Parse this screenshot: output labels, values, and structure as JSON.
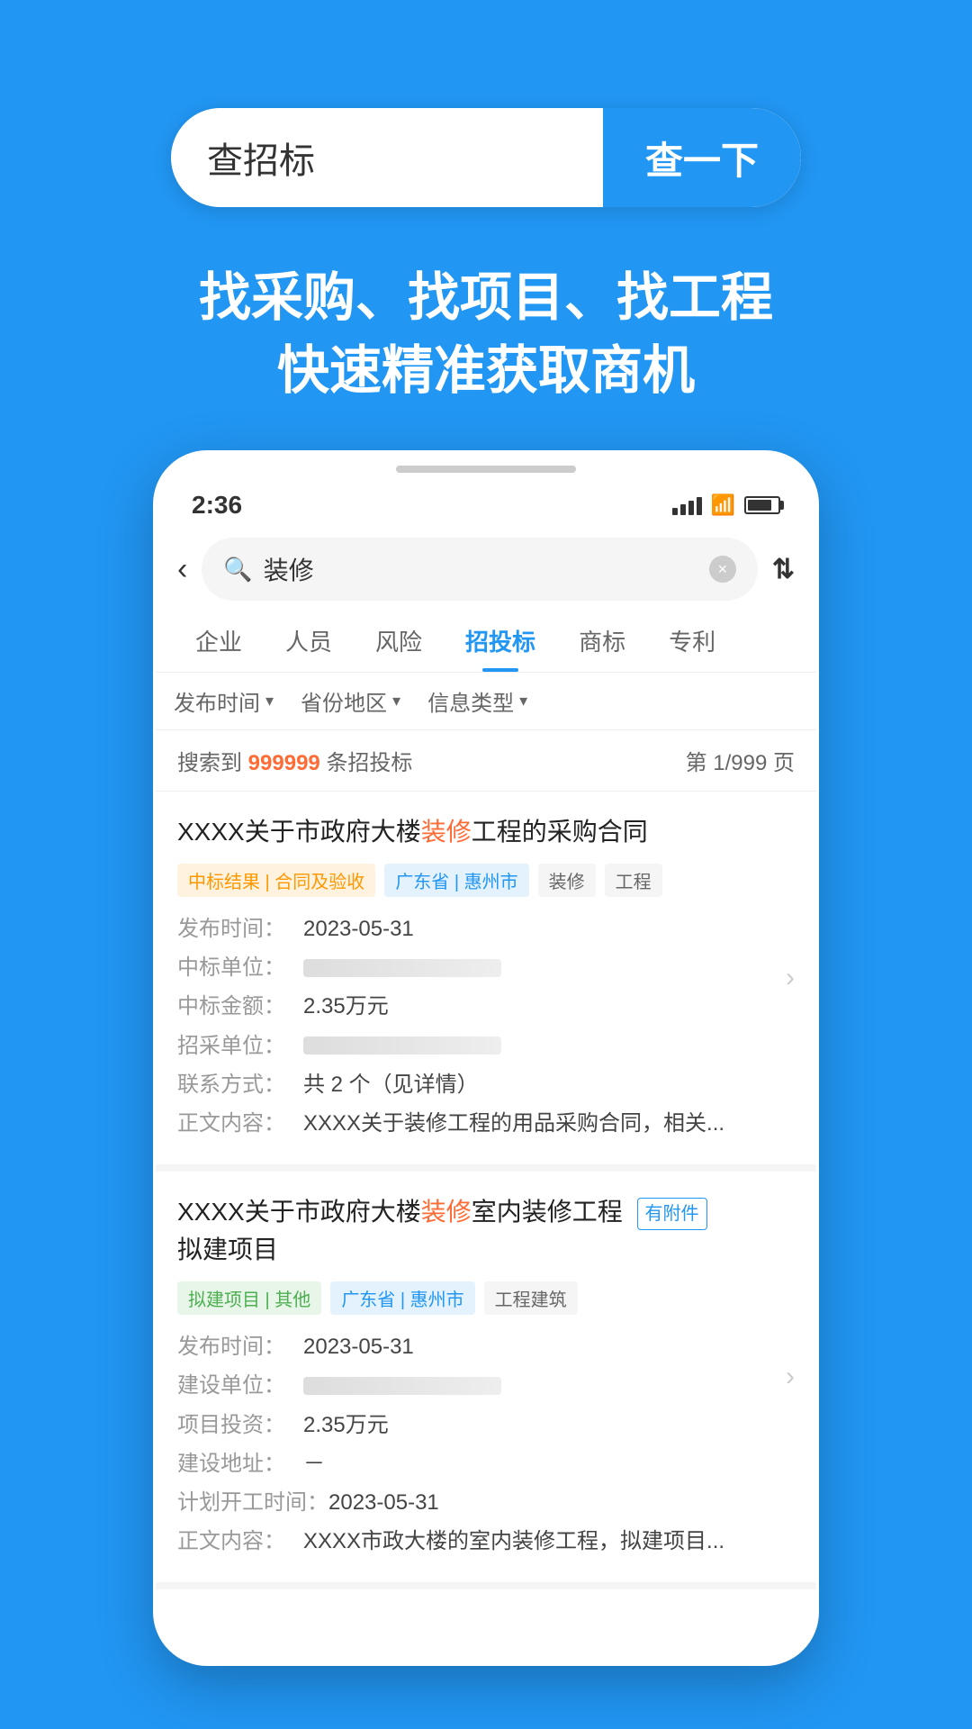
{
  "app": {
    "bg_color": "#2196F3"
  },
  "search_bar": {
    "placeholder": "查招标",
    "button_label": "查一下"
  },
  "tagline": {
    "line1": "找采购、找项目、找工程",
    "line2": "快速精准获取商机"
  },
  "phone": {
    "status_bar": {
      "time": "2:36"
    },
    "search": {
      "keyword": "装修",
      "back_label": "‹",
      "clear_label": "×"
    },
    "tabs": [
      {
        "label": "企业",
        "active": false
      },
      {
        "label": "人员",
        "active": false
      },
      {
        "label": "风险",
        "active": false
      },
      {
        "label": "招投标",
        "active": true
      },
      {
        "label": "商标",
        "active": false
      },
      {
        "label": "专利",
        "active": false
      }
    ],
    "filters": [
      {
        "label": "发布时间"
      },
      {
        "label": "省份地区"
      },
      {
        "label": "信息类型"
      }
    ],
    "result_count": {
      "prefix": "搜索到 ",
      "count": "999999",
      "suffix": " 条招投标",
      "page_info": "第 1/999 页"
    },
    "results": [
      {
        "title_prefix": "XXXX关于市政府大楼",
        "title_keyword": "装修",
        "title_suffix": "工程的采购合同",
        "has_attachment": false,
        "tags": [
          {
            "label": "中标结果 | 合同及验收",
            "type": "orange"
          },
          {
            "label": "广东省 | 惠州市",
            "type": "blue"
          },
          {
            "label": "装修",
            "type": "gray"
          },
          {
            "label": "工程",
            "type": "gray"
          }
        ],
        "details": [
          {
            "label": "发布时间：",
            "value": "2023-05-31",
            "blurred": false
          },
          {
            "label": "中标单位：",
            "value": "",
            "blurred": true
          },
          {
            "label": "中标金额：",
            "value": "2.35万元",
            "blurred": false
          },
          {
            "label": "招采单位：",
            "value": "",
            "blurred": true
          },
          {
            "label": "联系方式：",
            "value": "共 2 个（见详情）",
            "blurred": false
          },
          {
            "label": "正文内容：",
            "value": "XXXX关于装修工程的用品采购合同，相关...",
            "blurred": false
          }
        ]
      },
      {
        "title_prefix": "XXXX关于市政府大楼",
        "title_keyword": "装修",
        "title_suffix": "室内装修工程",
        "title_line2": "拟建项目",
        "has_attachment": true,
        "attachment_label": "有附件",
        "tags": [
          {
            "label": "拟建项目 | 其他",
            "type": "green"
          },
          {
            "label": "广东省 | 惠州市",
            "type": "blue"
          },
          {
            "label": "工程建筑",
            "type": "gray"
          }
        ],
        "details": [
          {
            "label": "发布时间：",
            "value": "2023-05-31",
            "blurred": false
          },
          {
            "label": "建设单位：",
            "value": "",
            "blurred": true
          },
          {
            "label": "项目投资：",
            "value": "2.35万元",
            "blurred": false
          },
          {
            "label": "建设地址：",
            "value": "－",
            "blurred": false
          },
          {
            "label": "计划开工时间：",
            "value": "2023-05-31",
            "blurred": false
          },
          {
            "label": "正文内容：",
            "value": "XXXX市政大楼的室内装修工程，拟建项目...",
            "blurred": false
          }
        ]
      }
    ]
  }
}
